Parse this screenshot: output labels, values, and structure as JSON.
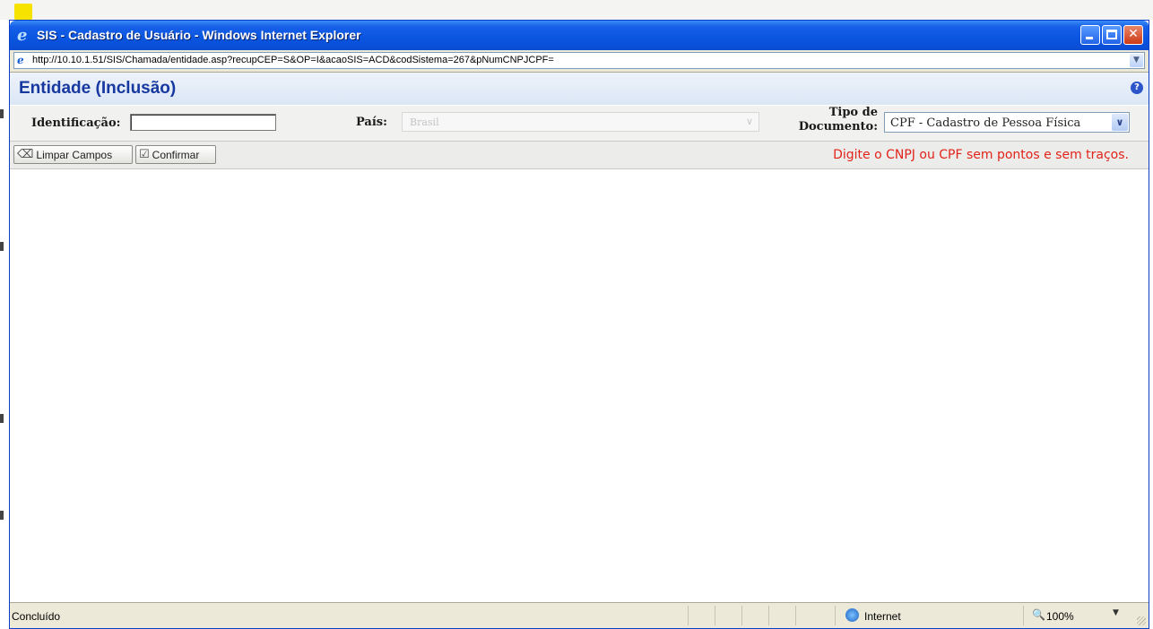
{
  "window": {
    "title": "SIS - Cadastro de Usuário - Windows Internet Explorer",
    "address": "http://10.10.1.51/SIS/Chamada/entidade.asp?recupCEP=S&OP=I&acaoSIS=ACD&codSistema=267&pNumCNPJCPF="
  },
  "page": {
    "title": "Entidade (Inclusão)"
  },
  "form": {
    "identificacao_label": "Identificação:",
    "identificacao_value": "",
    "pais_label": "País:",
    "pais_value": "Brasil",
    "tipo_label_1": "Tipo de",
    "tipo_label_2": "Documento:",
    "tipo_value": "CPF - Cadastro de Pessoa Física"
  },
  "toolbar": {
    "limpar_label": "Limpar Campos",
    "confirmar_label": "Confirmar",
    "hint": "Digite o CNPJ ou CPF sem pontos e sem traços."
  },
  "status": {
    "text": "Concluído",
    "zone": "Internet",
    "zoom": "100%"
  },
  "colors": {
    "title_blue": "#17399f",
    "hint_red": "#e2231a",
    "xp_titlebar": "#0a55e0"
  }
}
